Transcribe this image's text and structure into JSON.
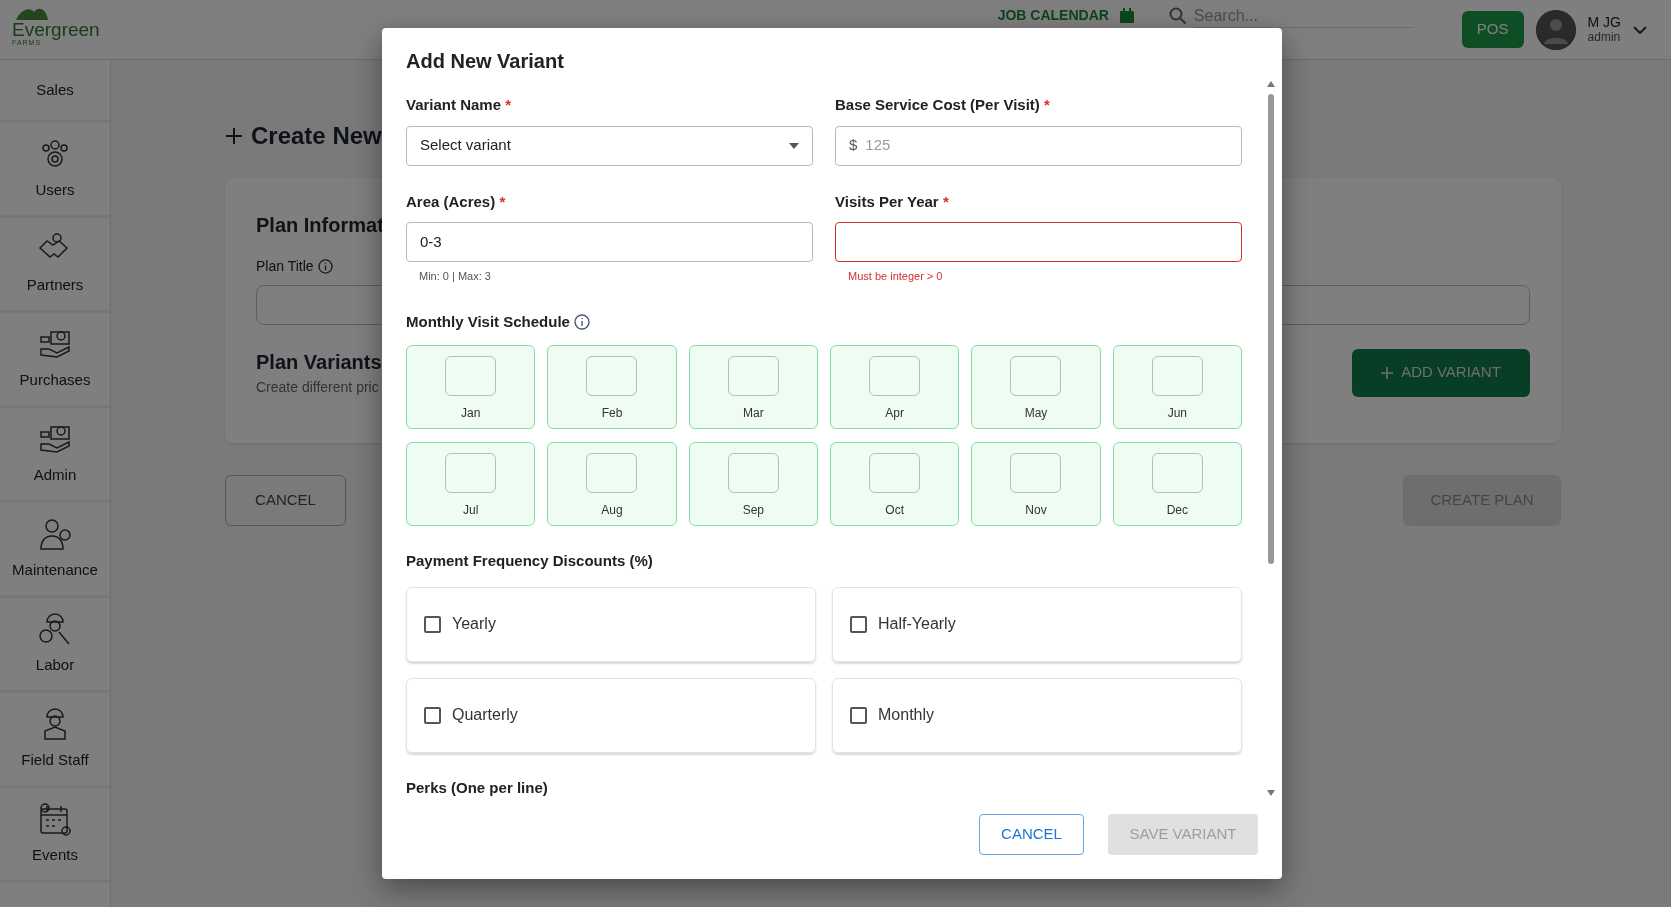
{
  "header": {
    "logo_text": "Evergreen",
    "logo_subtext": "FARMS",
    "calendar_link": "JOB CALENDAR",
    "search": {
      "placeholder": "Search..."
    },
    "pos_button": "POS",
    "user": {
      "name": "M JG",
      "role": "admin"
    }
  },
  "sidebar": {
    "items": [
      {
        "label": "Sales"
      },
      {
        "label": "Users"
      },
      {
        "label": "Partners"
      },
      {
        "label": "Purchases"
      },
      {
        "label": "Admin"
      },
      {
        "label": "Maintenance"
      },
      {
        "label": "Labor"
      },
      {
        "label": "Field Staff"
      },
      {
        "label": "Events"
      }
    ]
  },
  "page": {
    "title": "Create New",
    "card": {
      "heading": "Plan Informat",
      "field_label": "Plan Title",
      "variants_heading": "Plan Variants",
      "variants_subtitle": "Create different pric",
      "add_button": "ADD VARIANT"
    },
    "cancel_button": "CANCEL",
    "create_button": {
      "label": "CREATE PLAN",
      "disabled": true
    }
  },
  "modal": {
    "title": "Add New Variant",
    "fields": [
      {
        "label": "Variant Name",
        "required_mark": "*",
        "kind": "select",
        "value": "Select variant",
        "error": false
      },
      {
        "label": "Base Service Cost (Per Visit)",
        "required_mark": "*",
        "kind": "money",
        "prefix": "$",
        "placeholder": "125",
        "error": false
      },
      {
        "label": "Area (Acres)",
        "required_mark": "*",
        "kind": "text",
        "value": "0-3",
        "helper": "Min: 0 | Max: 3",
        "error": false
      },
      {
        "label": "Visits Per Year",
        "required_mark": "*",
        "kind": "text",
        "helper": "Must be integer > 0",
        "error": true
      }
    ],
    "schedule": {
      "label": "Monthly Visit Schedule",
      "months": [
        "Jan",
        "Feb",
        "Mar",
        "Apr",
        "May",
        "Jun",
        "Jul",
        "Aug",
        "Sep",
        "Oct",
        "Nov",
        "Dec"
      ]
    },
    "discounts": {
      "label": "Payment Frequency Discounts (%)",
      "options": [
        {
          "label": "Yearly",
          "checked": false
        },
        {
          "label": "Half-Yearly",
          "checked": false
        },
        {
          "label": "Quarterly",
          "checked": false
        },
        {
          "label": "Monthly",
          "checked": false
        }
      ]
    },
    "perks_label": "Perks (One per line)",
    "cancel_button": "CANCEL",
    "save_button": {
      "label": "SAVE VARIANT",
      "disabled": true
    }
  }
}
